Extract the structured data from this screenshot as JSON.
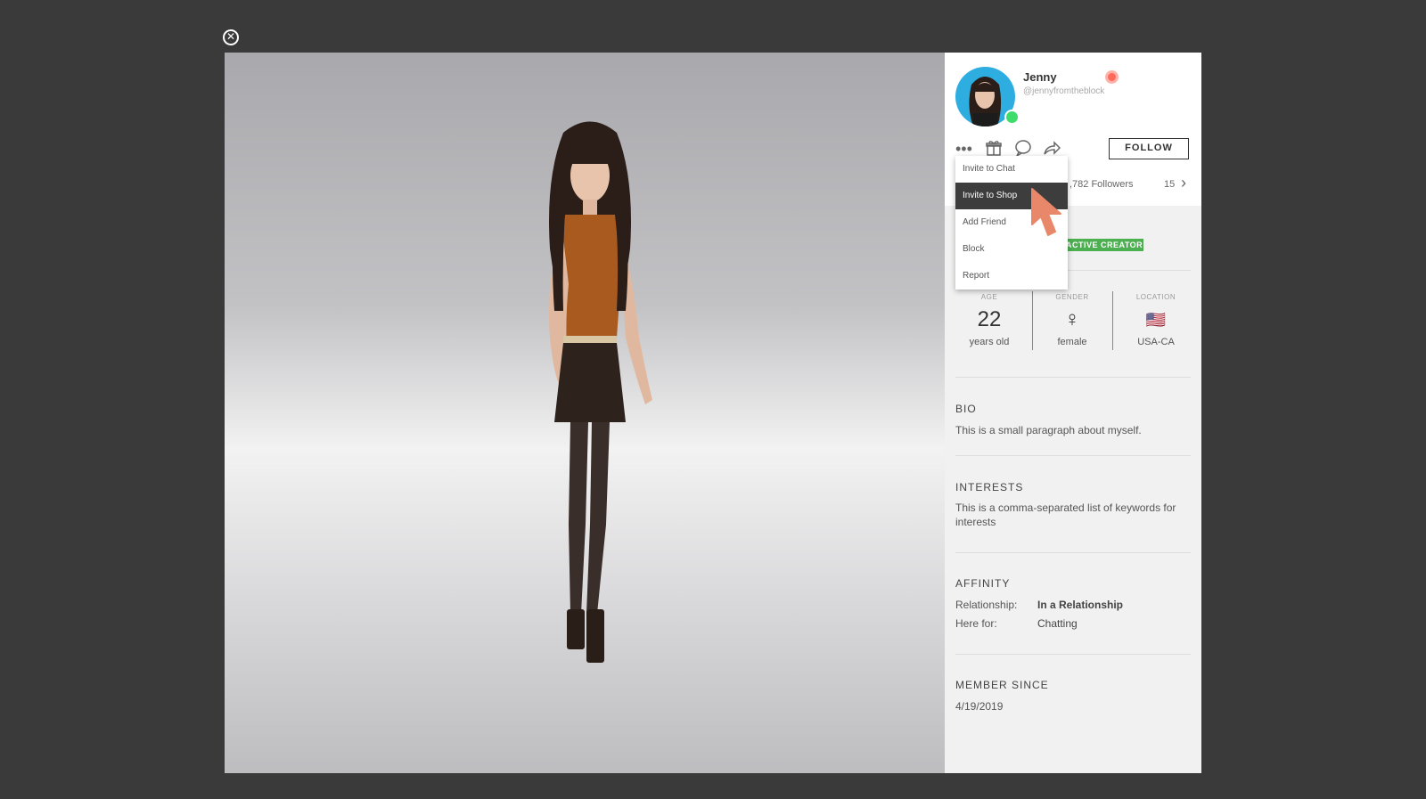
{
  "close_label": "✕",
  "profile": {
    "name": "Jenny",
    "handle": "@jennyfromtheblock",
    "follow_label": "FOLLOW",
    "followers_text": ",782 Followers",
    "following_count": "15",
    "creator_tag": "ACTIVE CREATOR"
  },
  "menu": {
    "items": [
      {
        "label": "Invite to Chat"
      },
      {
        "label": "Invite to Shop"
      },
      {
        "label": "Add Friend"
      },
      {
        "label": "Block"
      },
      {
        "label": "Report"
      }
    ],
    "active_index": 1
  },
  "info": {
    "age_label": "AGE",
    "age_value": "22",
    "age_sub": "years old",
    "gender_label": "GENDER",
    "gender_icon": "♀",
    "gender_sub": "female",
    "location_label": "LOCATION",
    "location_flag": "🇺🇸",
    "location_sub": "USA-CA"
  },
  "bio": {
    "title": "BIO",
    "text": "This is a small paragraph about myself."
  },
  "interests": {
    "title": "INTERESTS",
    "text": "This is a comma-separated list of keywords for interests"
  },
  "affinity": {
    "title": "AFFINITY",
    "relationship_key": "Relationship:",
    "relationship_val": "In a Relationship",
    "herefor_key": "Here for:",
    "herefor_val": "Chatting"
  },
  "member": {
    "title": "MEMBER SINCE",
    "date": "4/19/2019"
  },
  "colors": {
    "creator": "#4caf50",
    "online": "#3ddc6b",
    "cursor": "#e8876a"
  }
}
